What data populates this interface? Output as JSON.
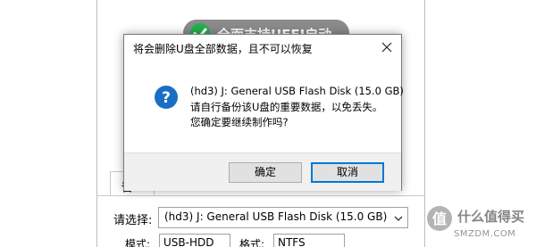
{
  "background": {
    "uefi_banner": "全面支持UEFI启动",
    "tab_label": "普",
    "select_label": "请选择:",
    "select_value": "(hd3) J: General USB Flash Disk (15.0 GB)",
    "mode_label": "模式:",
    "mode_value": "USB-HDD",
    "format_label": "格式:",
    "format_value": "NTFS"
  },
  "dialog": {
    "title": "将会删除U盘全部数据，且不可以恢复",
    "icon": "question-icon",
    "message_lines": [
      "(hd3) J: General USB Flash Disk (15.0 GB)",
      "请自行备份该U盘的重要数据，以免丢失。",
      "您确定要继续制作吗?"
    ],
    "ok_label": "确定",
    "cancel_label": "取消"
  },
  "watermark": {
    "text": "什么值得买",
    "sub": "SMZDM.COM"
  },
  "colors": {
    "accent": "#0078d7",
    "question_icon": "#1a6fc4",
    "uefi_check": "#22b14c",
    "uefi_pill": "#8b8b8b"
  }
}
